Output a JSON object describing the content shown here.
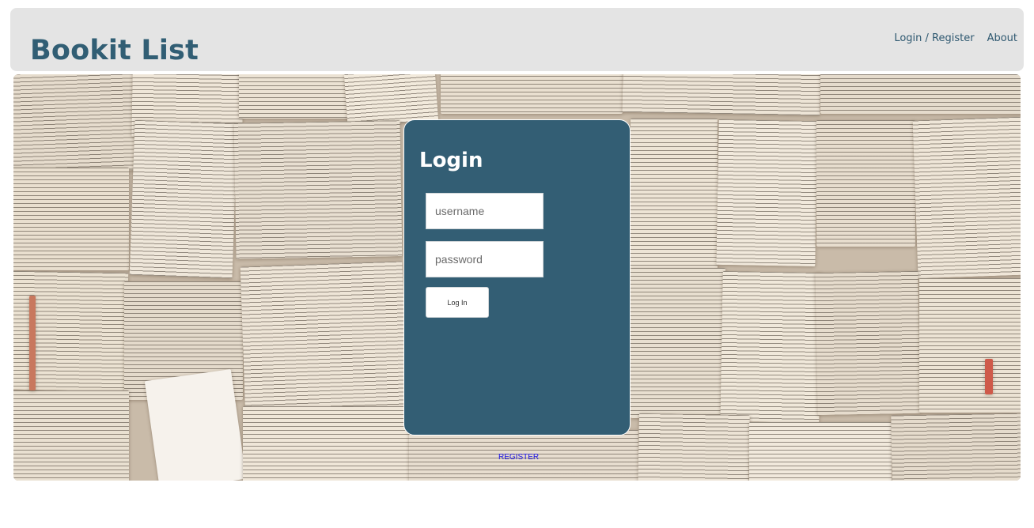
{
  "header": {
    "title": "Bookit List",
    "nav": {
      "login_register": "Login / Register",
      "about": "About"
    }
  },
  "login": {
    "title": "Login",
    "username_placeholder": "username",
    "password_placeholder": "password",
    "submit_label": "Log In"
  },
  "register_link": "REGISTER",
  "colors": {
    "brand": "#315e74",
    "card": "#335e74",
    "header_bg": "#e4e4e4",
    "register_link": "#1a12e6"
  }
}
